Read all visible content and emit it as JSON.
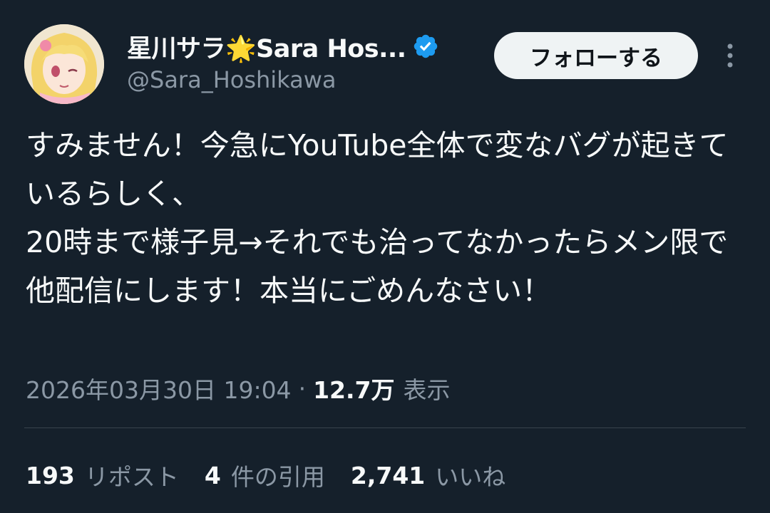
{
  "author": {
    "display_name": "星川サラ🌟Sara Hos...",
    "handle": "@Sara_Hoshikawa",
    "verified": true
  },
  "follow_button_label": "フォローする",
  "more_icon": "more-vertical-icon",
  "tweet": {
    "text": "すみません！今急にYouTube全体で変なバグが起きているらしく、\n20時まで様子見→それでも治ってなかったらメン限で他配信にします！本当にごめんなさい！"
  },
  "meta": {
    "timestamp": "2026年03月30日 19:04",
    "separator": "·",
    "views_count": "12.7万",
    "views_label": "表示"
  },
  "stats": [
    {
      "count": "193",
      "label": "リポスト"
    },
    {
      "count": "4",
      "label": "件の引用"
    },
    {
      "count": "2,741",
      "label": "いいね"
    }
  ],
  "colors": {
    "background": "#15202b",
    "text_primary": "#f7f9f9",
    "text_secondary": "#8b98a5",
    "verified_blue": "#1d9bf0",
    "follow_bg": "#eff3f4",
    "divider": "#38444d"
  }
}
